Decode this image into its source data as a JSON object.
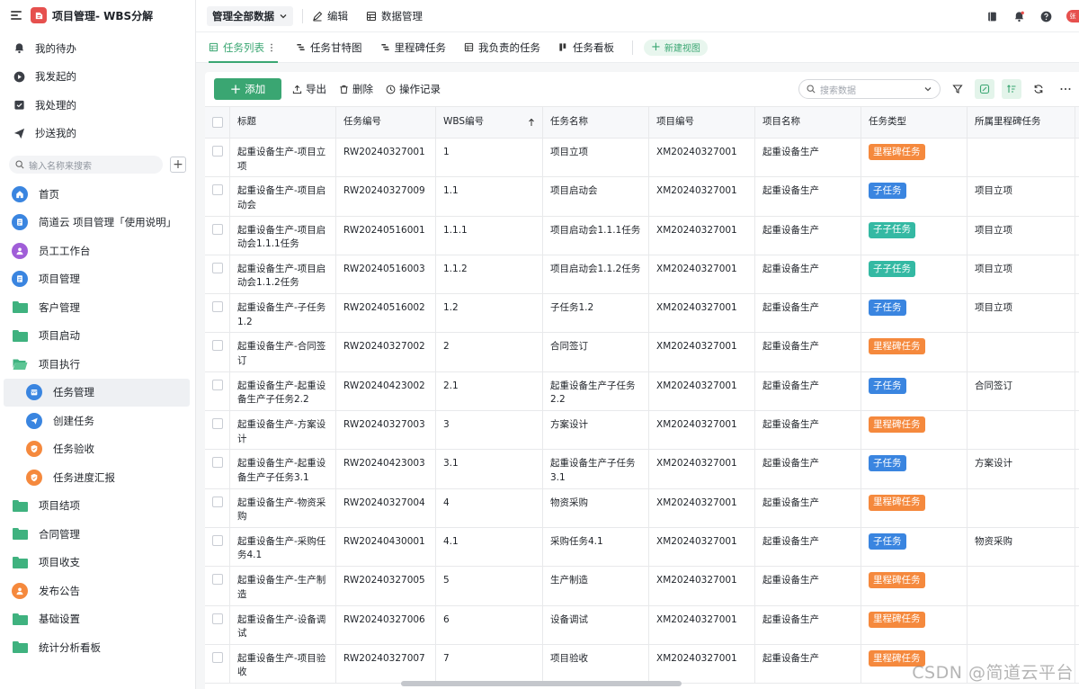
{
  "app": {
    "title": "项目管理- WBS分解"
  },
  "sidebar": {
    "quick": [
      {
        "label": "我的待办",
        "icon": "bell-icon"
      },
      {
        "label": "我发起的",
        "icon": "play-circle-icon"
      },
      {
        "label": "我处理的",
        "icon": "inbox-check-icon"
      },
      {
        "label": "抄送我的",
        "icon": "send-icon"
      }
    ],
    "search_placeholder": "输入名称来搜索",
    "nav": [
      {
        "label": "首页",
        "icon": "home-icon",
        "color": "#3a85e0"
      },
      {
        "label": "简道云 项目管理「使用说明」",
        "icon": "document-icon",
        "color": "#3a85e0"
      },
      {
        "label": "员工工作台",
        "icon": "user-icon",
        "color": "#a05ed8"
      },
      {
        "label": "项目管理",
        "icon": "document-icon",
        "color": "#3a85e0"
      },
      {
        "label": "客户管理",
        "icon": "folder-icon"
      },
      {
        "label": "项目启动",
        "icon": "folder-icon"
      },
      {
        "label": "项目执行",
        "icon": "folder-open-icon"
      },
      {
        "label": "任务管理",
        "icon": "calendar-icon",
        "color": "#3a85e0"
      },
      {
        "label": "创建任务",
        "icon": "send-circle-icon",
        "color": "#3a85e0"
      },
      {
        "label": "任务验收",
        "icon": "shield-check-icon",
        "color": "#f5893d"
      },
      {
        "label": "任务进度汇报",
        "icon": "shield-check-icon",
        "color": "#f5893d"
      },
      {
        "label": "项目结项",
        "icon": "folder-icon"
      },
      {
        "label": "合同管理",
        "icon": "folder-icon"
      },
      {
        "label": "项目收支",
        "icon": "folder-icon"
      },
      {
        "label": "发布公告",
        "icon": "user-icon",
        "color": "#f5893d"
      },
      {
        "label": "基础设置",
        "icon": "folder-icon"
      },
      {
        "label": "统计分析看板",
        "icon": "folder-icon"
      }
    ]
  },
  "topbar": {
    "view_select": "管理全部数据",
    "edit": "编辑",
    "data_manage": "数据管理",
    "avatar_text": "张"
  },
  "tabs": [
    {
      "label": "任务列表",
      "active": true
    },
    {
      "label": "任务甘特图"
    },
    {
      "label": "里程碑任务"
    },
    {
      "label": "我负责的任务"
    },
    {
      "label": "任务看板"
    }
  ],
  "new_view": "新建视图",
  "toolbar": {
    "add": "添加",
    "export": "导出",
    "delete": "删除",
    "history": "操作记录",
    "search_placeholder": "搜索数据"
  },
  "table": {
    "columns": [
      "标题",
      "任务编号",
      "WBS编号",
      "任务名称",
      "项目编号",
      "项目名称",
      "任务类型",
      "所属里程碑任务"
    ],
    "rows": [
      {
        "title": "起重设备生产-项目立项",
        "code": "RW20240327001",
        "wbs": "1",
        "name": "项目立项",
        "pcode": "XM20240327001",
        "pname": "起重设备生产",
        "type": "里程碑任务",
        "tcls": "milestone",
        "mile": ""
      },
      {
        "title": "起重设备生产-项目启动会",
        "code": "RW20240327009",
        "wbs": "1.1",
        "name": "项目启动会",
        "pcode": "XM20240327001",
        "pname": "起重设备生产",
        "type": "子任务",
        "tcls": "sub",
        "mile": "项目立项"
      },
      {
        "title": "起重设备生产-项目启动会1.1.1任务",
        "code": "RW20240516001",
        "wbs": "1.1.1",
        "name": "项目启动会1.1.1任务",
        "pcode": "XM20240327001",
        "pname": "起重设备生产",
        "type": "子子任务",
        "tcls": "subsub",
        "mile": "项目立项"
      },
      {
        "title": "起重设备生产-项目启动会1.1.2任务",
        "code": "RW20240516003",
        "wbs": "1.1.2",
        "name": "项目启动会1.1.2任务",
        "pcode": "XM20240327001",
        "pname": "起重设备生产",
        "type": "子子任务",
        "tcls": "subsub",
        "mile": "项目立项"
      },
      {
        "title": "起重设备生产-子任务1.2",
        "code": "RW20240516002",
        "wbs": "1.2",
        "name": "子任务1.2",
        "pcode": "XM20240327001",
        "pname": "起重设备生产",
        "type": "子任务",
        "tcls": "sub",
        "mile": "项目立项"
      },
      {
        "title": "起重设备生产-合同签订",
        "code": "RW20240327002",
        "wbs": "2",
        "name": "合同签订",
        "pcode": "XM20240327001",
        "pname": "起重设备生产",
        "type": "里程碑任务",
        "tcls": "milestone",
        "mile": ""
      },
      {
        "title": "起重设备生产-起重设备生产子任务2.2",
        "code": "RW20240423002",
        "wbs": "2.1",
        "name": "起重设备生产子任务2.2",
        "pcode": "XM20240327001",
        "pname": "起重设备生产",
        "type": "子任务",
        "tcls": "sub",
        "mile": "合同签订"
      },
      {
        "title": "起重设备生产-方案设计",
        "code": "RW20240327003",
        "wbs": "3",
        "name": "方案设计",
        "pcode": "XM20240327001",
        "pname": "起重设备生产",
        "type": "里程碑任务",
        "tcls": "milestone",
        "mile": ""
      },
      {
        "title": "起重设备生产-起重设备生产子任务3.1",
        "code": "RW20240423003",
        "wbs": "3.1",
        "name": "起重设备生产子任务3.1",
        "pcode": "XM20240327001",
        "pname": "起重设备生产",
        "type": "子任务",
        "tcls": "sub",
        "mile": "方案设计"
      },
      {
        "title": "起重设备生产-物资采购",
        "code": "RW20240327004",
        "wbs": "4",
        "name": "物资采购",
        "pcode": "XM20240327001",
        "pname": "起重设备生产",
        "type": "里程碑任务",
        "tcls": "milestone",
        "mile": ""
      },
      {
        "title": "起重设备生产-采购任务4.1",
        "code": "RW20240430001",
        "wbs": "4.1",
        "name": "采购任务4.1",
        "pcode": "XM20240327001",
        "pname": "起重设备生产",
        "type": "子任务",
        "tcls": "sub",
        "mile": "物资采购"
      },
      {
        "title": "起重设备生产-生产制造",
        "code": "RW20240327005",
        "wbs": "5",
        "name": "生产制造",
        "pcode": "XM20240327001",
        "pname": "起重设备生产",
        "type": "里程碑任务",
        "tcls": "milestone",
        "mile": ""
      },
      {
        "title": "起重设备生产-设备调试",
        "code": "RW20240327006",
        "wbs": "6",
        "name": "设备调试",
        "pcode": "XM20240327001",
        "pname": "起重设备生产",
        "type": "里程碑任务",
        "tcls": "milestone",
        "mile": ""
      },
      {
        "title": "起重设备生产-项目验收",
        "code": "RW20240327007",
        "wbs": "7",
        "name": "项目验收",
        "pcode": "XM20240327001",
        "pname": "起重设备生产",
        "type": "里程碑任务",
        "tcls": "milestone",
        "mile": ""
      }
    ]
  },
  "watermark": "CSDN @简道云平台",
  "colors": {
    "accent": "#3aa672",
    "milestone": "#f5893d",
    "subtask": "#3a85e0",
    "subsubtask": "#34b9a3"
  }
}
